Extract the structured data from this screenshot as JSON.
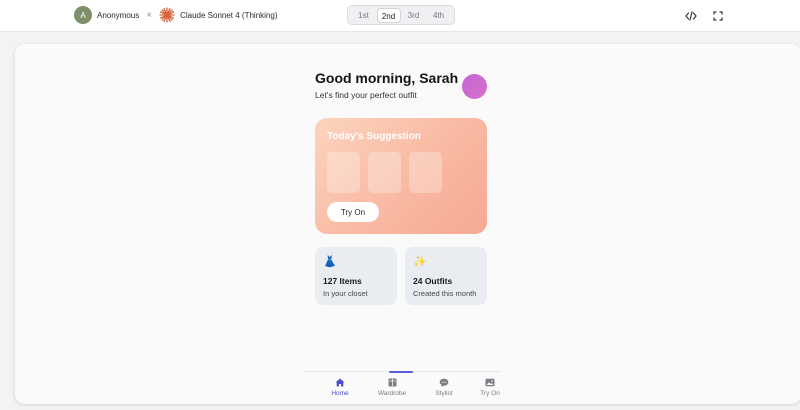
{
  "topbar": {
    "user_initial": "A",
    "user_name": "Anonymous",
    "separator": "×",
    "model_name": "Claude Sonnet 4 (Thinking)",
    "rank_tabs": [
      {
        "label": "1st",
        "active": false
      },
      {
        "label": "2nd",
        "active": true
      },
      {
        "label": "3rd",
        "active": false
      },
      {
        "label": "4th",
        "active": false
      }
    ],
    "code_icon": "code-icon",
    "fullscreen_icon": "fullscreen-icon"
  },
  "app": {
    "greeting": "Good morning, Sarah",
    "subtitle": "Let's find your perfect outfit",
    "suggestion": {
      "title": "Today's Suggestion",
      "button_label": "Try On"
    },
    "stats": [
      {
        "icon": "dress-icon",
        "glyph": "👗",
        "number": "127 Items",
        "caption": "In your closet"
      },
      {
        "icon": "sparkles-icon",
        "glyph": "✨",
        "number": "24 Outfits",
        "caption": "Created this month"
      }
    ],
    "nav": [
      {
        "label": "Home",
        "icon": "home-icon",
        "active": true
      },
      {
        "label": "Wardrobe",
        "icon": "wardrobe-icon",
        "active": false
      },
      {
        "label": "Stylist",
        "icon": "chat-icon",
        "active": false
      },
      {
        "label": "Try On",
        "icon": "image-icon",
        "active": false
      }
    ]
  },
  "colors": {
    "accent": "#5b5bd6",
    "card_gradient_start": "#fcd4be",
    "card_gradient_end": "#f6a994",
    "profile": "#cc68d2"
  }
}
